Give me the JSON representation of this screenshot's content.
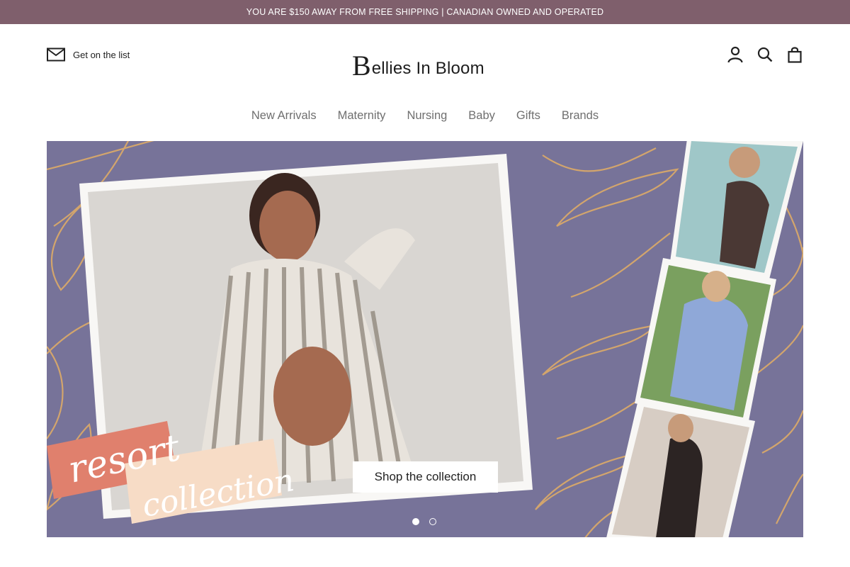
{
  "announcement": {
    "text": "YOU ARE $150 AWAY FROM FREE SHIPPING | CANADIAN OWNED AND OPERATED"
  },
  "header": {
    "newsletter_label": "Get on the list",
    "logo": {
      "text": "ellies In Bloom",
      "initial": "B"
    },
    "icons": [
      "account-icon",
      "search-icon",
      "cart-icon"
    ]
  },
  "nav": {
    "items": [
      {
        "label": "New Arrivals"
      },
      {
        "label": "Maternity"
      },
      {
        "label": "Nursing"
      },
      {
        "label": "Baby"
      },
      {
        "label": "Gifts"
      },
      {
        "label": "Brands"
      }
    ]
  },
  "hero": {
    "artwork_text": {
      "line1": "resort",
      "line2": "collection"
    },
    "cta_label": "Shop the collection",
    "slides": {
      "count": 2,
      "active": 1
    }
  },
  "colors": {
    "announcement_bg": "#7f5f6c",
    "hero_bg": "#777399",
    "leaf_gold": "#d8a86a",
    "banner_coral": "#e0806d",
    "banner_cream": "#f7dcc6"
  }
}
